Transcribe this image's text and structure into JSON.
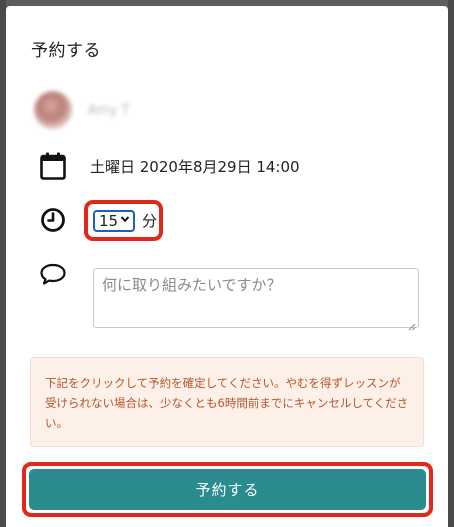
{
  "modal": {
    "title": "予約する"
  },
  "tutor": {
    "name": "Amy T"
  },
  "booking": {
    "date": "土曜日 2020年8月29日 14:00",
    "duration_value": "15",
    "duration_unit": "分"
  },
  "message": {
    "placeholder": "何に取り組みたいですか？"
  },
  "notice": {
    "text": "下記をクリックして予約を確定してください。やむを得ずレッスンが受けられない場合は、少なくとも6時間前までにキャンセルしてください。"
  },
  "submit": {
    "label": "予約する"
  },
  "colors": {
    "accent": "#2a8c8f",
    "highlight": "#e0291a",
    "notice_bg": "#fdf0e8",
    "notice_text": "#b5562b"
  },
  "icons": {
    "date": "calendar-icon",
    "duration": "clock-icon",
    "message": "speech-bubble-icon"
  }
}
